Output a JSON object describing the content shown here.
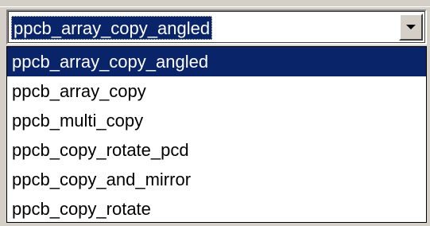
{
  "combo": {
    "selected_value": "ppcb_array_copy_angled",
    "dropdown_icon": "chevron-down-icon"
  },
  "dropdown": {
    "options": [
      "ppcb_array_copy_angled",
      "ppcb_array_copy",
      "ppcb_multi_copy",
      "ppcb_copy_rotate_pcd",
      "ppcb_copy_and_mirror",
      "ppcb_copy_rotate"
    ],
    "highlighted_index": 0
  },
  "colors": {
    "selection_bg": "#0a246a",
    "selection_fg": "#ffffff",
    "window_bg": "#d4d0c8"
  }
}
